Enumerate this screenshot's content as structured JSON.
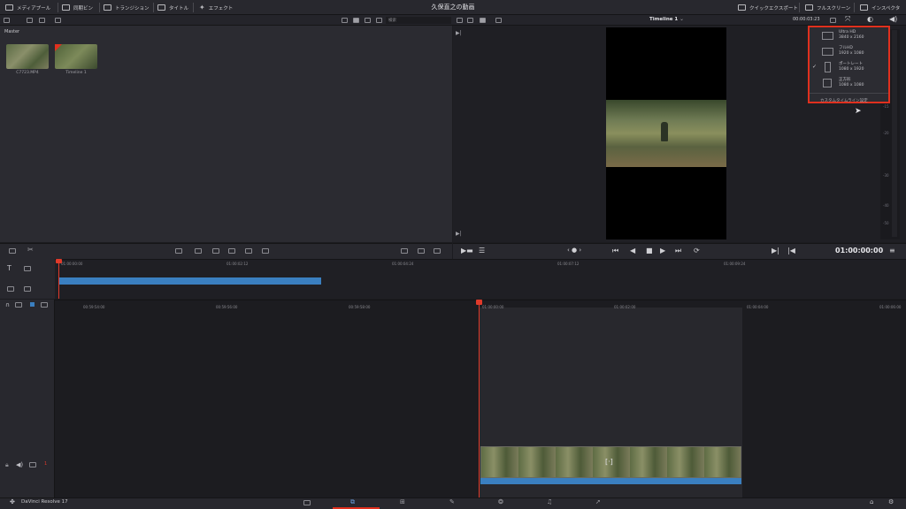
{
  "topbar": {
    "items_left": [
      {
        "label": "メディアプール",
        "icon": "media-pool-icon"
      },
      {
        "label": "同期ビン",
        "icon": "sync-bin-icon"
      },
      {
        "label": "トランジション",
        "icon": "transitions-icon"
      },
      {
        "label": "タイトル",
        "icon": "titles-icon"
      },
      {
        "label": "エフェクト",
        "icon": "effects-icon"
      }
    ],
    "project_title": "久保直之の動画",
    "items_right": [
      {
        "label": "クイックエクスポート",
        "icon": "quick-export-icon"
      },
      {
        "label": "フルスクリーン",
        "icon": "fullscreen-icon"
      },
      {
        "label": "インスペクタ",
        "icon": "inspector-icon"
      }
    ]
  },
  "toolbar2": {
    "search_placeholder": "検索",
    "timeline_name": "Timeline 1",
    "duration": "00:00:03:23"
  },
  "pool": {
    "bin_name": "Master",
    "clips": [
      {
        "label": "C7723.MP4"
      },
      {
        "label": "Timeline 1"
      }
    ]
  },
  "resolution_menu": {
    "items": [
      {
        "name": "Ultra HD",
        "size": "3840 x 2160",
        "checked": false
      },
      {
        "name": "フルHD",
        "size": "1920 x 1080",
        "checked": false
      },
      {
        "name": "ポートレート",
        "size": "1080 x 1920",
        "checked": true
      },
      {
        "name": "正方形",
        "size": "1080 x 1080",
        "checked": false
      }
    ],
    "footer": "カスタムタイムライン設定",
    "check_glyph": "✓"
  },
  "meter": {
    "labels": [
      "-5",
      "-10",
      "-15",
      "-20",
      "-30",
      "-40",
      "-50"
    ]
  },
  "viewer": {
    "timecode": "01:00:00:00"
  },
  "upper_timeline": {
    "ticks": [
      "01:00:00:00",
      "01:00:02:12",
      "01:00:04:24",
      "01:00:07:12",
      "01:00:09:24"
    ]
  },
  "lower_timeline": {
    "ticks": [
      "00:59:54:00",
      "00:59:56:00",
      "00:59:58:00",
      "01:00:00:00",
      "01:00:02:00",
      "01:00:04:00",
      "01:00:06:00"
    ],
    "track_number": "1"
  },
  "bottom": {
    "app_name": "DaVinci Resolve 17",
    "pages": [
      "media-page-icon",
      "cut-page-icon",
      "edit-page-icon",
      "fusion-page-icon",
      "color-page-icon",
      "fairlight-page-icon",
      "deliver-page-icon"
    ],
    "active_page": "cut-page-icon"
  },
  "colors": {
    "accent": "#e0301e",
    "clip_blue": "#3a7fc0",
    "playhead": "#e03a2a"
  }
}
